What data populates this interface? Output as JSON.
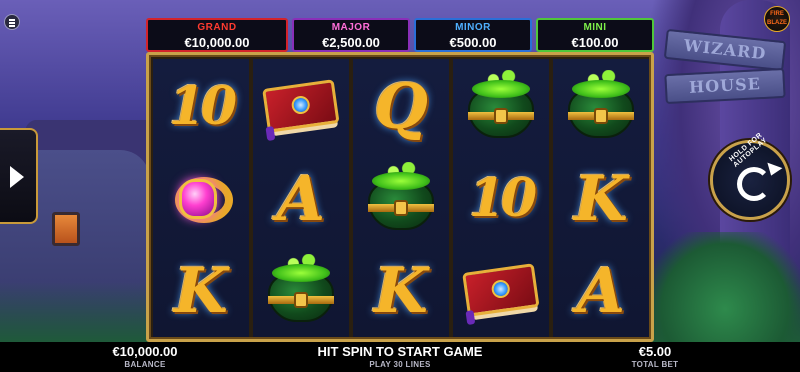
{
  "jackpots": {
    "grand": {
      "label": "GRAND",
      "value": "€10,000.00"
    },
    "major": {
      "label": "MAJOR",
      "value": "€2,500.00"
    },
    "minor": {
      "label": "MINOR",
      "value": "€500.00"
    },
    "mini": {
      "label": "MINI",
      "value": "€100.00"
    }
  },
  "reels": [
    [
      "10",
      "ring",
      "K"
    ],
    [
      "spellbook",
      "A",
      "cauldron"
    ],
    [
      "Q",
      "cauldron",
      "K"
    ],
    [
      "cauldron",
      "10",
      "spellbook"
    ],
    [
      "cauldron",
      "K",
      "A"
    ]
  ],
  "scenery": {
    "sign_top": "WIZARD",
    "sign_bottom": "HOUSE"
  },
  "logo": {
    "text_top": "FIRE",
    "text_bottom": "BLAZE"
  },
  "autoplay": {
    "label": "HOLD FOR AUTOPLAY"
  },
  "bottom_bar": {
    "balance_value": "€10,000.00",
    "balance_label": "BALANCE",
    "message": "HIT SPIN TO START GAME",
    "lines": "PLAY 30 LINES",
    "bet_value": "€5.00",
    "bet_label": "TOTAL BET"
  },
  "colors": {
    "grand": "#d3232b",
    "major": "#8a2fb8",
    "minor": "#2a6fd8",
    "mini": "#4fc73a",
    "frame_gold": "#c9a24a"
  },
  "icons": {
    "menu": "hamburger-icon",
    "side_arrow": "play-arrow-icon",
    "spin": "spin-arrow-icon"
  }
}
